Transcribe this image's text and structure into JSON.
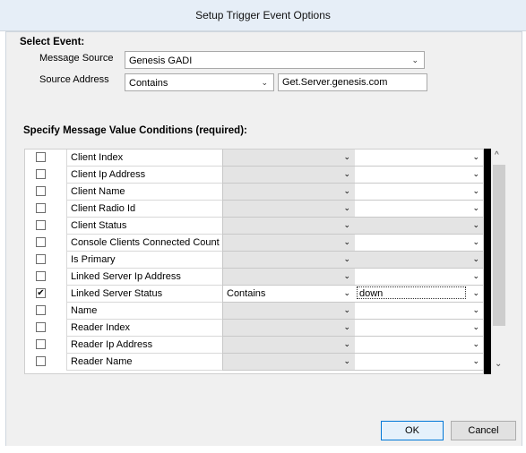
{
  "window": {
    "title": "Setup Trigger Event Options"
  },
  "select_event": {
    "heading": "Select Event:",
    "message_source_label": "Message Source",
    "message_source_value": "Genesis GADI",
    "source_address_label": "Source Address",
    "source_address_operator": "Contains",
    "source_address_value": "Get.Server.genesis.com"
  },
  "conditions": {
    "heading": "Specify Message Value Conditions (required):",
    "rows": [
      {
        "checked": "",
        "name": "Client Index",
        "operator": "",
        "value": ""
      },
      {
        "checked": "",
        "name": "Client Ip Address",
        "operator": "",
        "value": ""
      },
      {
        "checked": "",
        "name": "Client Name",
        "operator": "",
        "value": ""
      },
      {
        "checked": "",
        "name": "Client Radio Id",
        "operator": "",
        "value": ""
      },
      {
        "checked": "",
        "name": "Client Status",
        "operator": "",
        "value": ""
      },
      {
        "checked": "",
        "name": "Console Clients Connected Count",
        "operator": "",
        "value": ""
      },
      {
        "checked": "",
        "name": "Is Primary",
        "operator": "",
        "value": ""
      },
      {
        "checked": "",
        "name": "Linked Server Ip Address",
        "operator": "",
        "value": ""
      },
      {
        "checked": "✔",
        "name": "Linked Server Status",
        "operator": "Contains",
        "value": "down"
      },
      {
        "checked": "",
        "name": "Name",
        "operator": "",
        "value": ""
      },
      {
        "checked": "",
        "name": "Reader Index",
        "operator": "",
        "value": ""
      },
      {
        "checked": "",
        "name": "Reader Ip Address",
        "operator": "",
        "value": ""
      },
      {
        "checked": "",
        "name": "Reader Name",
        "operator": "",
        "value": ""
      }
    ]
  },
  "buttons": {
    "ok": "OK",
    "cancel": "Cancel"
  },
  "icons": {
    "dropdown": "chevron-down-icon",
    "scroll_up": "scroll-up-icon",
    "scroll_down": "scroll-down-icon"
  }
}
